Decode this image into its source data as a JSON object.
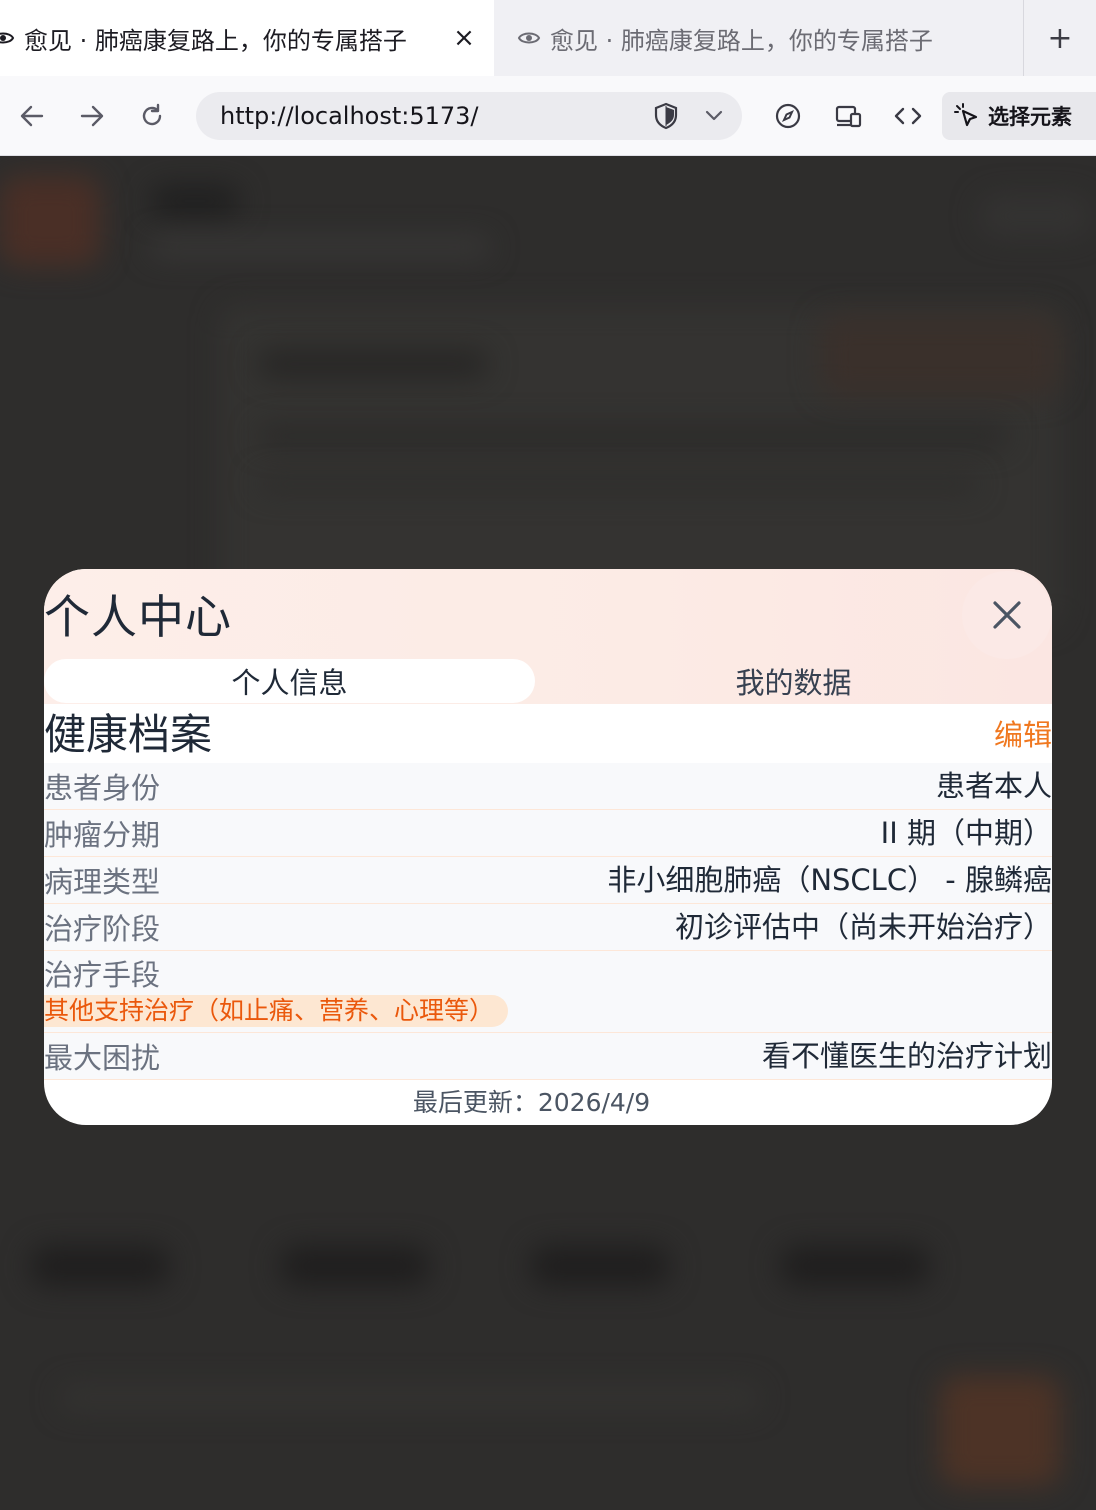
{
  "browser": {
    "tabs": [
      {
        "title": "愈见 · 肺癌康复路上，你的专属搭子",
        "active": true,
        "close_label": "×"
      },
      {
        "title": "愈见 · 肺癌康复路上，你的专属搭子",
        "active": false
      }
    ],
    "new_tab_label": "+",
    "url": "http://localhost:5173/",
    "select_element_label": "选择元素"
  },
  "modal": {
    "title": "个人中心",
    "close_label": "✕",
    "tabs": [
      {
        "label": "个人信息",
        "active": true
      },
      {
        "label": "我的数据",
        "active": false
      }
    ],
    "section_title": "健康档案",
    "edit_label": "编辑",
    "fields": [
      {
        "label": "患者身份",
        "value": "患者本人"
      },
      {
        "label": "肿瘤分期",
        "value": "II 期（中期）"
      },
      {
        "label": "病理类型",
        "value": "非小细胞肺癌（NSCLC） - 腺鳞癌"
      },
      {
        "label": "治疗阶段",
        "value": "初诊评估中（尚未开始治疗）"
      },
      {
        "label": "治疗手段",
        "tags": [
          "其他支持治疗（如止痛、营养、心理等）"
        ]
      },
      {
        "label": "最大困扰",
        "value": "看不懂医生的治疗计划"
      }
    ],
    "footer": "最后更新：2026/4/9"
  },
  "colors": {
    "accent": "#f07820",
    "chip_bg": "#fde7d2",
    "chip_text": "#ea580c",
    "header_gradient_start": "#fdeee9",
    "header_gradient_end": "#fbe6e2",
    "overlay_bg": "#2e2d2c"
  }
}
